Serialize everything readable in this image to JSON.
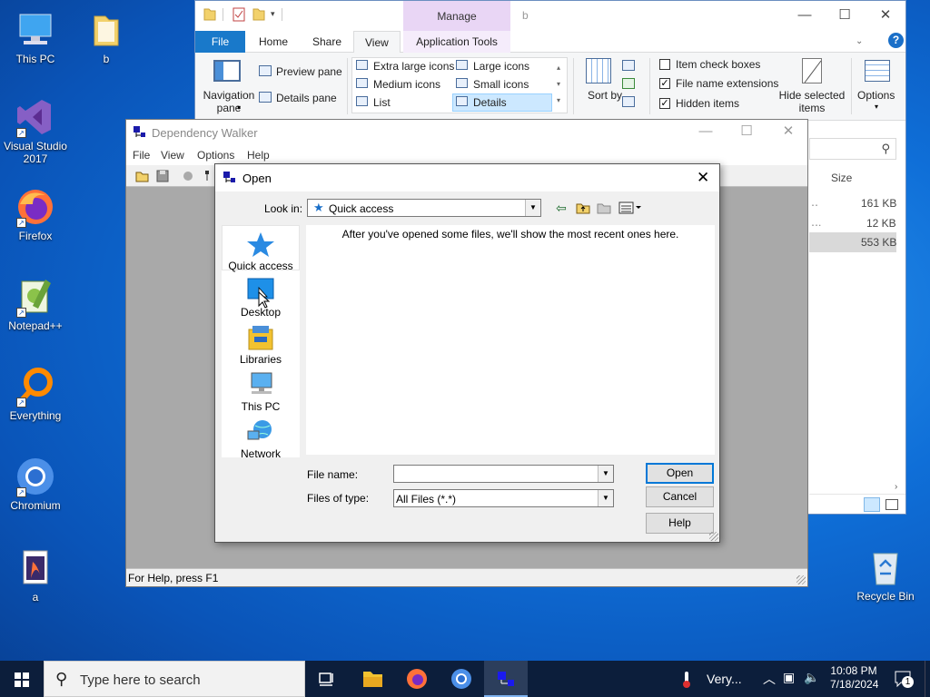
{
  "desktop": {
    "icons": [
      {
        "label": "This PC"
      },
      {
        "label": "b"
      },
      {
        "label": "Visual Studio 2017"
      },
      {
        "label": "Firefox"
      },
      {
        "label": "Notepad++"
      },
      {
        "label": "Everything"
      },
      {
        "label": "Chromium"
      },
      {
        "label": "a"
      },
      {
        "label": "Recycle Bin"
      }
    ]
  },
  "explorer": {
    "title": "b",
    "contextual_tab": "Manage",
    "tabs": [
      "File",
      "Home",
      "Share",
      "View",
      "Application Tools"
    ],
    "ribbon": {
      "navigation_pane": "Navigation pane",
      "preview_pane": "Preview pane",
      "details_pane": "Details pane",
      "layouts": [
        "Extra large icons",
        "Large icons",
        "Medium icons",
        "Small icons",
        "List",
        "Details"
      ],
      "sort_by": "Sort by",
      "item_check_boxes": "Item check boxes",
      "file_name_extensions": "File name extensions",
      "hidden_items": "Hidden items",
      "hide_selected_items": "Hide selected items",
      "options": "Options"
    },
    "column_size": "Size",
    "sizes": [
      "161 KB",
      "12 KB",
      "553 KB"
    ]
  },
  "depwalker": {
    "title": "Dependency Walker",
    "menu": [
      "File",
      "View",
      "Options",
      "Help"
    ],
    "status": "For Help, press F1"
  },
  "dialog": {
    "title": "Open",
    "look_in_label": "Look in:",
    "look_in_value": "Quick access",
    "places": [
      "Quick access",
      "Desktop",
      "Libraries",
      "This PC",
      "Network"
    ],
    "empty_message": "After you've opened some files, we'll show the most recent ones here.",
    "file_name_label": "File name:",
    "file_name_value": "",
    "files_of_type_label": "Files of type:",
    "files_of_type_value": "All Files (*.*)",
    "buttons": {
      "open": "Open",
      "cancel": "Cancel",
      "help": "Help"
    }
  },
  "taskbar": {
    "search_placeholder": "Type here to search",
    "weather": "Very...",
    "time": "10:08 PM",
    "date": "7/18/2024",
    "notifications": "1"
  }
}
